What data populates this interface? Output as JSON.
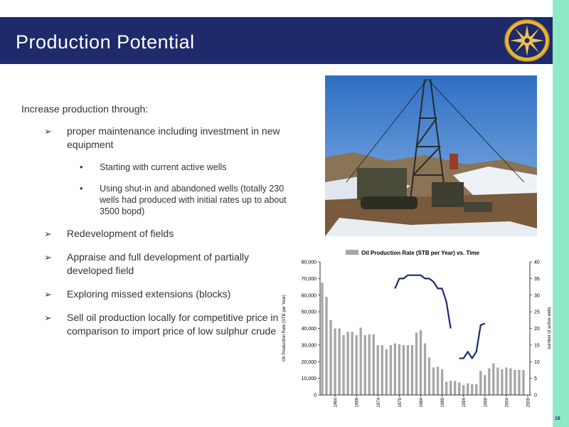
{
  "slide": {
    "title": "Production Potential",
    "page_number": "16",
    "colors": {
      "header": "#1f2a6b",
      "sidebar": "#8fe9c7",
      "bars": "#a6a6a6",
      "line": "#1f2a6b"
    }
  },
  "content": {
    "intro": "Increase production through:",
    "marker": "➢",
    "sub_marker": "•",
    "bullets": [
      {
        "text": "proper maintenance including investment in new equipment",
        "sub": [
          "Starting with current active wells",
          "Using shut-in and abandoned wells (totally 230 wells had produced with initial rates up to about 3500 bopd)"
        ]
      },
      {
        "text": "Redevelopment of fields"
      },
      {
        "text": "Appraise and full development of partially developed field"
      },
      {
        "text": "Exploring missed extensions (blocks)"
      },
      {
        "text": "Sell oil production locally for competitive price in comparison to import price of low sulphur crude"
      }
    ]
  },
  "photo": {
    "icon": "oil-drilling-rig-photo"
  },
  "logo": {
    "icon": "sun-emblem-icon"
  },
  "chart_data": {
    "type": "bar",
    "title": "Oil Production Rate (STB per Year) vs. Time",
    "legend": "Oil Production Rate (STB per Year) vs. Time",
    "legend_position": "top",
    "ylabel": "Oil Production Rate (STB per Year)",
    "y2label": "number of active wells",
    "ylim": [
      0,
      80000
    ],
    "y2lim": [
      0,
      40
    ],
    "yticks": [
      "0",
      "10,000",
      "20,000",
      "30,000",
      "40,000",
      "50,000",
      "60,000",
      "70,000",
      "80,000"
    ],
    "y2ticks": [
      "0",
      "5",
      "10",
      "15",
      "20",
      "25",
      "30",
      "35",
      "40"
    ],
    "xticks": [
      "1964",
      "1969",
      "1974",
      "1979",
      "1984",
      "1989",
      "1994",
      "1999",
      "2004",
      "2009"
    ],
    "x": [
      1961,
      1962,
      1963,
      1964,
      1965,
      1966,
      1967,
      1968,
      1969,
      1970,
      1971,
      1972,
      1973,
      1974,
      1975,
      1976,
      1977,
      1978,
      1979,
      1980,
      1981,
      1982,
      1983,
      1984,
      1985,
      1986,
      1987,
      1988,
      1989,
      1990,
      1991,
      1992,
      1993,
      1994,
      1995,
      1996,
      1997,
      1998,
      1999,
      2000,
      2001,
      2002,
      2003,
      2004,
      2005,
      2006,
      2007,
      2008
    ],
    "values": [
      67500,
      59000,
      45000,
      40000,
      40000,
      36000,
      38000,
      38000,
      36000,
      40500,
      36000,
      36500,
      36500,
      30000,
      30000,
      27500,
      30000,
      31000,
      30500,
      30000,
      30000,
      30000,
      37500,
      39000,
      31000,
      22500,
      16500,
      17000,
      15500,
      8000,
      8500,
      8500,
      7500,
      6000,
      7000,
      6500,
      6500,
      14500,
      12000,
      16000,
      19000,
      16500,
      15500,
      16500,
      16000,
      15000,
      15000,
      15000
    ],
    "line_segments": [
      {
        "x": [
          1978,
          1979,
          1980,
          1981,
          1982,
          1983,
          1984,
          1985,
          1986,
          1987,
          1988,
          1989,
          1990,
          1991
        ],
        "y": [
          32,
          35,
          35,
          36,
          36,
          36,
          36,
          35,
          35,
          34,
          32,
          32,
          28,
          20
        ]
      },
      {
        "x": [
          1993,
          1994,
          1995,
          1996,
          1997,
          1998,
          1999
        ],
        "y": [
          11,
          11,
          13,
          11,
          13,
          21,
          21.5
        ]
      }
    ]
  }
}
